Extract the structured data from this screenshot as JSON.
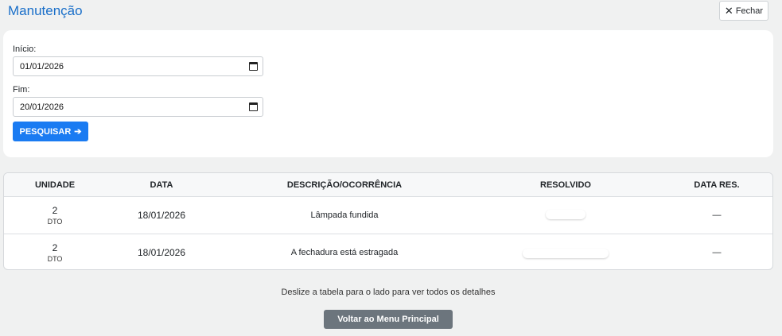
{
  "header": {
    "title": "Manutenção",
    "close_label": "Fechar"
  },
  "filters": {
    "start_label": "Início:",
    "start_value": "01/01/2026",
    "end_label": "Fim:",
    "end_value": "20/01/2026",
    "search_label": "PESQUISAR",
    "search_arrow": "➔"
  },
  "table": {
    "columns": [
      "UNIDADE",
      "DATA",
      "DESCRIÇÃO/OCORRÊNCIA",
      "RESOLVIDO",
      "DATA RES."
    ],
    "rows": [
      {
        "unit": "2",
        "unit_sub": "DTO",
        "date": "18/01/2026",
        "description": "Lâmpada fundida",
        "resolved_date": "—"
      },
      {
        "unit": "2",
        "unit_sub": "DTO",
        "date": "18/01/2026",
        "description": "A fechadura está estragada",
        "resolved_date": "—"
      }
    ]
  },
  "footer": {
    "hint": "Deslize a tabela para o lado para ver todos os detalhes",
    "back_label": "Voltar ao Menu Principal"
  },
  "colors": {
    "accent": "#1a7bf2",
    "title": "#1a6fc9",
    "secondary_button": "#6c757d"
  }
}
